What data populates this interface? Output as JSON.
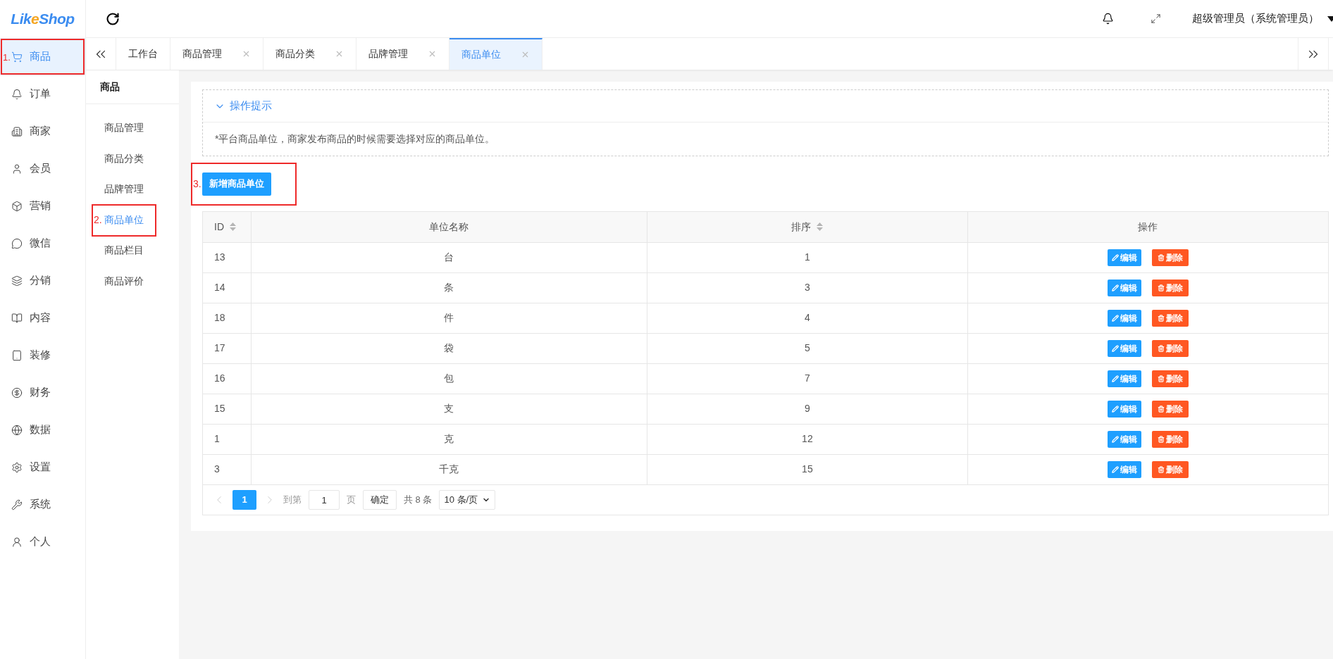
{
  "logo": {
    "parts": [
      {
        "text": "Lik",
        "accent": false
      },
      {
        "text": "e",
        "accent": true
      },
      {
        "text": "Shop",
        "accent": false
      }
    ]
  },
  "nav": [
    {
      "kind": "cart",
      "label": "商品",
      "selected": true,
      "annotation": "1."
    },
    {
      "kind": "bell",
      "label": "订单",
      "selected": false
    },
    {
      "kind": "building",
      "label": "商家",
      "selected": false
    },
    {
      "kind": "user",
      "label": "会员",
      "selected": false
    },
    {
      "kind": "box",
      "label": "营销",
      "selected": false
    },
    {
      "kind": "chat",
      "label": "微信",
      "selected": false
    },
    {
      "kind": "layers",
      "label": "分销",
      "selected": false
    },
    {
      "kind": "book",
      "label": "内容",
      "selected": false
    },
    {
      "kind": "tablet",
      "label": "装修",
      "selected": false
    },
    {
      "kind": "yen",
      "label": "财务",
      "selected": false
    },
    {
      "kind": "globe",
      "label": "数据",
      "selected": false
    },
    {
      "kind": "gear",
      "label": "设置",
      "selected": false
    },
    {
      "kind": "tools",
      "label": "系统",
      "selected": false
    },
    {
      "kind": "person",
      "label": "个人",
      "selected": false
    }
  ],
  "submenu": {
    "title": "商品",
    "items": [
      {
        "label": "商品管理",
        "selected": false
      },
      {
        "label": "商品分类",
        "selected": false
      },
      {
        "label": "品牌管理",
        "selected": false
      },
      {
        "label": "商品单位",
        "selected": true,
        "annotation": "2."
      },
      {
        "label": "商品栏目",
        "selected": false
      },
      {
        "label": "商品评价",
        "selected": false
      }
    ]
  },
  "topbar": {
    "user": "超级管理员（系统管理员）"
  },
  "tabs": [
    {
      "label": "工作台",
      "selected": false,
      "closable": false
    },
    {
      "label": "商品管理",
      "selected": false,
      "closable": true
    },
    {
      "label": "商品分类",
      "selected": false,
      "closable": true
    },
    {
      "label": "品牌管理",
      "selected": false,
      "closable": true
    },
    {
      "label": "商品单位",
      "selected": true,
      "closable": true
    }
  ],
  "tips": {
    "title": "操作提示",
    "expanded": true,
    "text": "*平台商品单位，商家发布商品的时候需要选择对应的商品单位。"
  },
  "add_button": {
    "label": "新增商品单位",
    "annotation": "3."
  },
  "table": {
    "columns": [
      {
        "label": "ID",
        "sortable": true
      },
      {
        "label": "单位名称",
        "sortable": false
      },
      {
        "label": "排序",
        "sortable": true
      },
      {
        "label": "操作",
        "sortable": false
      }
    ],
    "rows": [
      {
        "id": "13",
        "name": "台",
        "sort": "1",
        "edit": "编辑",
        "delete": "删除"
      },
      {
        "id": "14",
        "name": "条",
        "sort": "3",
        "edit": "编辑",
        "delete": "删除"
      },
      {
        "id": "18",
        "name": "件",
        "sort": "4",
        "edit": "编辑",
        "delete": "删除"
      },
      {
        "id": "17",
        "name": "袋",
        "sort": "5",
        "edit": "编辑",
        "delete": "删除"
      },
      {
        "id": "16",
        "name": "包",
        "sort": "7",
        "edit": "编辑",
        "delete": "删除"
      },
      {
        "id": "15",
        "name": "支",
        "sort": "9",
        "edit": "编辑",
        "delete": "删除"
      },
      {
        "id": "1",
        "name": "克",
        "sort": "12",
        "edit": "编辑",
        "delete": "删除"
      },
      {
        "id": "3",
        "name": "千克",
        "sort": "15",
        "edit": "编辑",
        "delete": "删除"
      }
    ]
  },
  "pagination": {
    "pages": [
      {
        "label": "1",
        "selected": true
      }
    ],
    "goto_label": "到第",
    "goto_value": "1",
    "page_unit": "页",
    "confirm": "确定",
    "total": "共 8 条",
    "page_size": "10 条/页"
  }
}
